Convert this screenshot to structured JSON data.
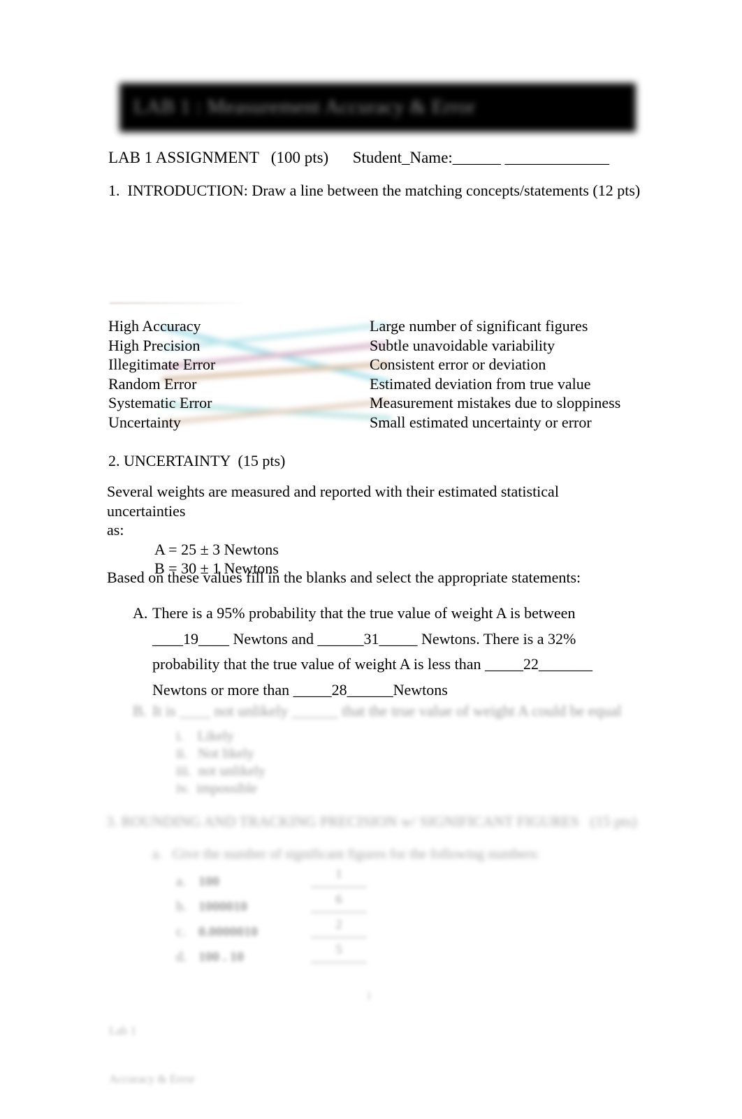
{
  "document": {
    "banner_title": "LAB 1 : Measurement Accuracy & Error",
    "assignment_line": "LAB 1 ASSIGNMENT   (100 pts)      Student_Name:______ _____________",
    "intro_line": "1.  INTRODUCTION: Draw a line between the matching concepts/statements (12 pts)"
  },
  "matching": {
    "left": [
      "High Accuracy",
      "High Precision",
      "Illegitimate Error",
      "Random Error",
      "Systematic Error",
      "Uncertainty"
    ],
    "right": [
      "Large number of significant figures",
      "Subtle unavoidable variability",
      "Consistent error or deviation",
      "Estimated deviation from true value",
      "Measurement mistakes due to sloppiness",
      "Small estimated uncertainty or error"
    ],
    "line_colors": [
      "#7fd4e0",
      "#c79bb5",
      "#bfa07a",
      "#a8d8d8",
      "#d3b7a0",
      "#9fd2cf"
    ]
  },
  "section2": {
    "heading": "2. UNCERTAINTY  (15 pts)",
    "intro_line1": "Several weights are measured and reported with their estimated statistical uncertainties",
    "intro_line2": "as:",
    "value_a": "A = 25 ± 3 Newtons",
    "value_b": "B = 30 ± 1 Newtons",
    "based_line": "Based on these values fill in the blanks and select the appropriate statements:",
    "item_a": {
      "marker": "A.",
      "text": "There is a 95% probability that the true value of weight A is between ____19____ Newtons and ______31_____ Newtons.  There is a 32% probability that the true value of weight A is less than _____22_______ Newtons or more than _____28______Newtons",
      "answers": [
        "19",
        "31",
        "22",
        "28"
      ]
    },
    "item_b": {
      "marker": "B.",
      "text": "It is ____ not unlikely ______ that the true value of weight A could be equal",
      "options": [
        "i.    Likely",
        "ii.   Not likely",
        "iii.  not unlikely",
        "iv.  impossible"
      ]
    }
  },
  "section3": {
    "heading": "3. ROUNDING AND TRACKING PRECISION w/ SIGNIFICANT FIGURES   (15 pts)",
    "sub_heading": "a.   Give the number of significant figures for the following numbers:",
    "rows": [
      {
        "label": "a.",
        "value": "100",
        "answer": "1",
        "blank": "________"
      },
      {
        "label": "b.",
        "value": "1000010",
        "answer": "6",
        "blank": "________"
      },
      {
        "label": "c.",
        "value": "0.0000010",
        "answer": "2",
        "blank": "________"
      },
      {
        "label": "d.",
        "value": "100 . 10",
        "answer": "5",
        "blank": "________"
      }
    ]
  },
  "footer": {
    "left_line1": "Lab 1",
    "left_line2": "Accuracy & Error",
    "page_number": "1"
  }
}
